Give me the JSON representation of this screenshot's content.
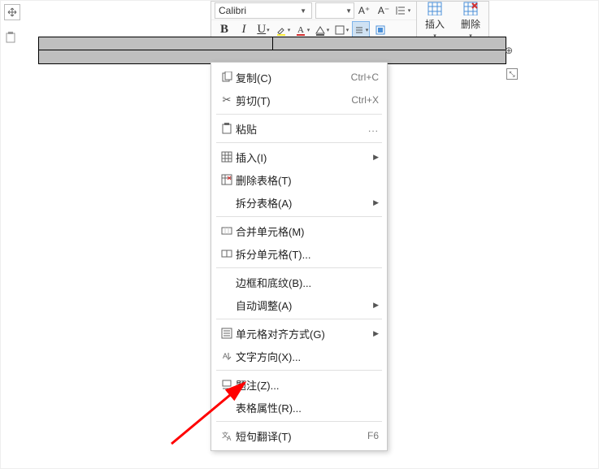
{
  "ribbon": {
    "font_name": "Calibri",
    "font_size": "",
    "a_plus": "A⁺",
    "a_minus": "A⁻",
    "bold": "B",
    "italic": "I",
    "underline": "U",
    "insert_label": "插入",
    "delete_label": "删除"
  },
  "context_menu": {
    "copy": {
      "label": "复制(C)",
      "shortcut": "Ctrl+C"
    },
    "cut": {
      "label": "剪切(T)",
      "shortcut": "Ctrl+X"
    },
    "paste": {
      "label": "粘贴",
      "dots": "..."
    },
    "insert": {
      "label": "插入(I)"
    },
    "delete_table": {
      "label": "删除表格(T)"
    },
    "split_table": {
      "label": "拆分表格(A)"
    },
    "merge_cells": {
      "label": "合并单元格(M)"
    },
    "split_cells": {
      "label": "拆分单元格(T)..."
    },
    "borders_shading": {
      "label": "边框和底纹(B)..."
    },
    "auto_fit": {
      "label": "自动调整(A)"
    },
    "cell_align": {
      "label": "单元格对齐方式(G)"
    },
    "text_direction": {
      "label": "文字方向(X)..."
    },
    "caption": {
      "label": "题注(Z)..."
    },
    "table_properties": {
      "label": "表格属性(R)..."
    },
    "translate": {
      "label": "短句翻译(T)",
      "shortcut": "F6"
    }
  }
}
